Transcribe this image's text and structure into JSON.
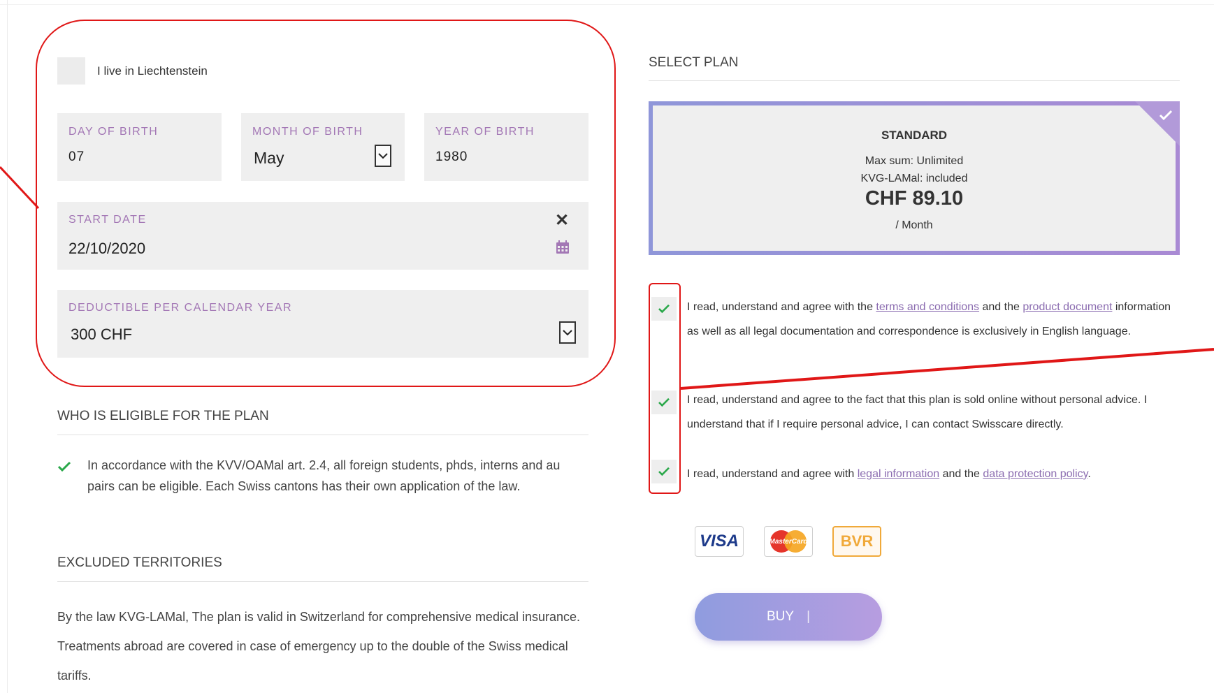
{
  "form": {
    "live_in_label": "I live in Liechtenstein",
    "day_label": "DAY OF BIRTH",
    "day_value": "07",
    "month_label": "MONTH OF BIRTH",
    "month_value": "May",
    "year_label": "YEAR OF BIRTH",
    "year_value": "1980",
    "start_label": "START DATE",
    "start_value": "22/10/2020",
    "deductible_label": "DEDUCTIBLE PER CALENDAR YEAR",
    "deductible_value": "300 CHF"
  },
  "eligible": {
    "title": "WHO IS ELIGIBLE FOR THE PLAN",
    "text": "In accordance with the KVV/OAMal art. 2.4, all foreign students, phds, interns and au pairs can be eligible. Each Swiss cantons has their own application of the law."
  },
  "excluded": {
    "title": "EXCLUDED TERRITORIES",
    "text": "By the law KVG-LAMal, The plan is valid in Switzerland for comprehensive medical insurance. Treatments abroad are covered in case of emergency up to the double of the Swiss medical tariffs."
  },
  "plan": {
    "section_title": "SELECT PLAN",
    "name": "STANDARD",
    "max_sum": "Max sum: Unlimited",
    "kvg": "KVG-LAMal: included",
    "price": "CHF 89.10",
    "period": "/ Month"
  },
  "agreements": {
    "a1_pre": "I read, understand and agree with the ",
    "a1_link1": "terms and conditions",
    "a1_mid": " and the ",
    "a1_link2": "product document",
    "a1_post": " information as well as all legal documentation and correspondence is exclusively in English language.",
    "a2": "I read, understand and agree to the fact that this plan is sold online without personal advice. I understand that if I require personal advice, I can contact Swisscare directly.",
    "a3_pre": "I read, understand and agree with ",
    "a3_link1": "legal information",
    "a3_mid": " and the ",
    "a3_link2": "data protection policy",
    "a3_post": "."
  },
  "payment": {
    "visa": "VISA",
    "mastercard": "MasterCard",
    "bvr": "BVR"
  },
  "buy": {
    "label": "BUY",
    "cursor": "|"
  },
  "colors": {
    "label_purple": "#a377b5",
    "check_green": "#2aa84a",
    "annotation_red": "#e01717",
    "link_purple": "#8b6cb0"
  }
}
